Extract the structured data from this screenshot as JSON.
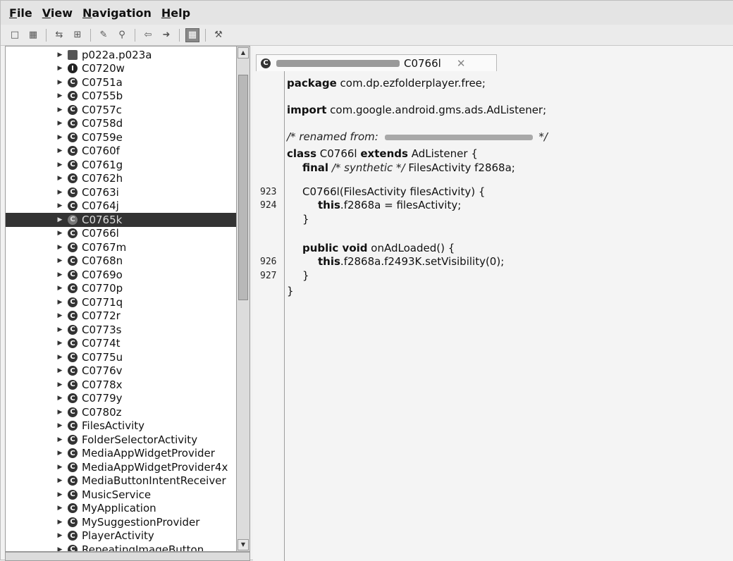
{
  "menu": {
    "file": {
      "key": "F",
      "rest": "ile"
    },
    "view": {
      "key": "V",
      "rest": "iew"
    },
    "navigation": {
      "key": "N",
      "rest": "avigation"
    },
    "help": {
      "key": "H",
      "rest": "elp"
    }
  },
  "toolbar": {
    "icons": [
      "open-file-icon",
      "save-all-icon",
      "sync-icon",
      "sync-tree-icon",
      "decompile-icon",
      "search-icon",
      "back-icon",
      "forward-icon",
      "flatten-packages-icon",
      "preferences-icon"
    ]
  },
  "tree": {
    "selected_index": 12,
    "items": [
      {
        "label": "p022a.p023a",
        "icon": "package-icon"
      },
      {
        "label": "C0720w",
        "icon": "interface-icon"
      },
      {
        "label": "C0751a",
        "icon": "class-icon"
      },
      {
        "label": "C0755b",
        "icon": "class-icon"
      },
      {
        "label": "C0757c",
        "icon": "class-icon"
      },
      {
        "label": "C0758d",
        "icon": "class-icon"
      },
      {
        "label": "C0759e",
        "icon": "class-icon"
      },
      {
        "label": "C0760f",
        "icon": "class-icon"
      },
      {
        "label": "C0761g",
        "icon": "class-icon"
      },
      {
        "label": "C0762h",
        "icon": "class-icon"
      },
      {
        "label": "C0763i",
        "icon": "class-icon"
      },
      {
        "label": "C0764j",
        "icon": "class-icon"
      },
      {
        "label": "C0765k",
        "icon": "class-icon"
      },
      {
        "label": "C0766l",
        "icon": "class-icon"
      },
      {
        "label": "C0767m",
        "icon": "class-icon"
      },
      {
        "label": "C0768n",
        "icon": "class-icon"
      },
      {
        "label": "C0769o",
        "icon": "class-icon"
      },
      {
        "label": "C0770p",
        "icon": "class-icon"
      },
      {
        "label": "C0771q",
        "icon": "class-icon"
      },
      {
        "label": "C0772r",
        "icon": "class-icon"
      },
      {
        "label": "C0773s",
        "icon": "class-icon"
      },
      {
        "label": "C0774t",
        "icon": "class-icon"
      },
      {
        "label": "C0775u",
        "icon": "class-icon"
      },
      {
        "label": "C0776v",
        "icon": "class-icon"
      },
      {
        "label": "C0778x",
        "icon": "class-icon"
      },
      {
        "label": "C0779y",
        "icon": "class-icon"
      },
      {
        "label": "C0780z",
        "icon": "class-icon"
      },
      {
        "label": "FilesActivity",
        "icon": "class-icon"
      },
      {
        "label": "FolderSelectorActivity",
        "icon": "class-icon"
      },
      {
        "label": "MediaAppWidgetProvider",
        "icon": "class-icon"
      },
      {
        "label": "MediaAppWidgetProvider4x",
        "icon": "class-icon"
      },
      {
        "label": "MediaButtonIntentReceiver",
        "icon": "class-icon"
      },
      {
        "label": "MusicService",
        "icon": "class-icon"
      },
      {
        "label": "MyApplication",
        "icon": "class-icon"
      },
      {
        "label": "MySuggestionProvider",
        "icon": "class-icon"
      },
      {
        "label": "PlayerActivity",
        "icon": "class-icon"
      },
      {
        "label": "RepeatingImageButton",
        "icon": "class-icon"
      }
    ]
  },
  "editor": {
    "tab": {
      "title": "C0766l",
      "close": "✕"
    },
    "line_numbers": [
      {
        "n": "923",
        "line": 5
      },
      {
        "n": "924",
        "line": 6
      },
      {
        "n": "926",
        "line": 9
      },
      {
        "n": "927",
        "line": 10
      }
    ],
    "code": [
      {
        "kw": "package",
        "text": " com.dp.ezfolderplayer.free;"
      },
      {
        "kw": "import",
        "text": " com.google.android.gms.ads.AdListener;"
      },
      {
        "comment": "/* renamed from: ",
        "comment_end": " */"
      },
      {
        "kw": "class",
        "text": " C0766l ",
        "kw2": "extends",
        "text2": " AdListener {"
      },
      {
        "indent": 1,
        "kw": "final",
        "comment": " /* synthetic */",
        "text": " FilesActivity f2868a;"
      },
      {
        "indent": 1,
        "text": "C0766l(FilesActivity filesActivity) {"
      },
      {
        "indent": 2,
        "kw": "this",
        "text": ".f2868a = filesActivity;"
      },
      {
        "indent": 1,
        "text": "}"
      },
      {
        "indent": 1,
        "kw": "public void",
        "text": " onAdLoaded() {"
      },
      {
        "indent": 2,
        "kw": "this",
        "text": ".f2868a.f2493K.setVisibility(0);"
      },
      {
        "indent": 1,
        "text": "}"
      },
      {
        "text": "}"
      }
    ]
  }
}
